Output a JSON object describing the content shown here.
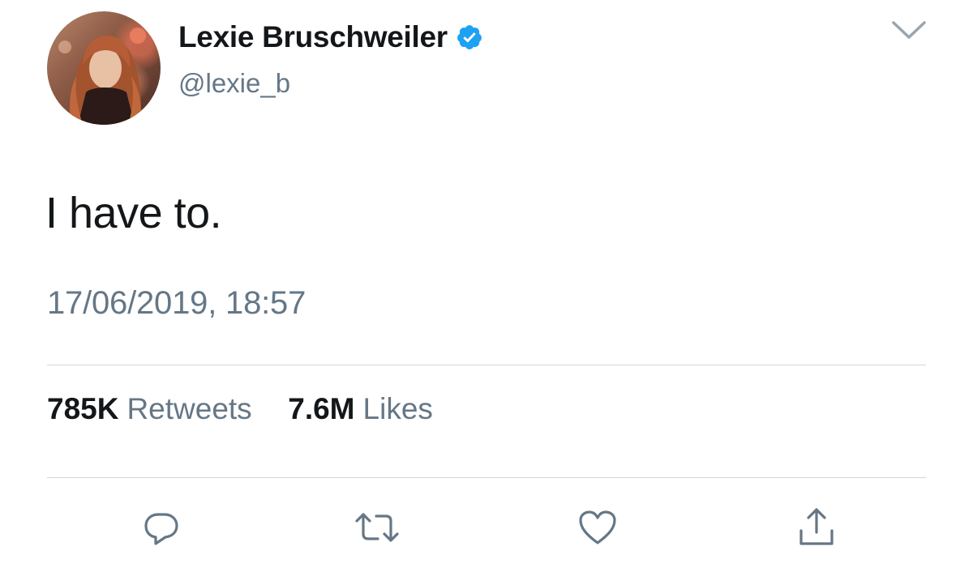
{
  "tweet": {
    "author": {
      "display_name": "Lexie Bruschweiler",
      "handle": "@lexie_b",
      "verified": true
    },
    "text": "I have to.",
    "timestamp": "17/06/2019, 18:57",
    "stats": {
      "retweets_count": "785K",
      "retweets_label": "Retweets",
      "likes_count": "7.6M",
      "likes_label": "Likes"
    }
  },
  "icons": {
    "menu": "chevron-down-icon",
    "verified": "verified-badge-icon",
    "reply": "reply-icon",
    "retweet": "retweet-icon",
    "like": "heart-icon",
    "share": "share-icon"
  },
  "colors": {
    "text_primary": "#14171a",
    "text_secondary": "#657786",
    "verified_blue": "#1da1f2",
    "icon_gray": "#657786",
    "divider": "#d4d7da"
  }
}
